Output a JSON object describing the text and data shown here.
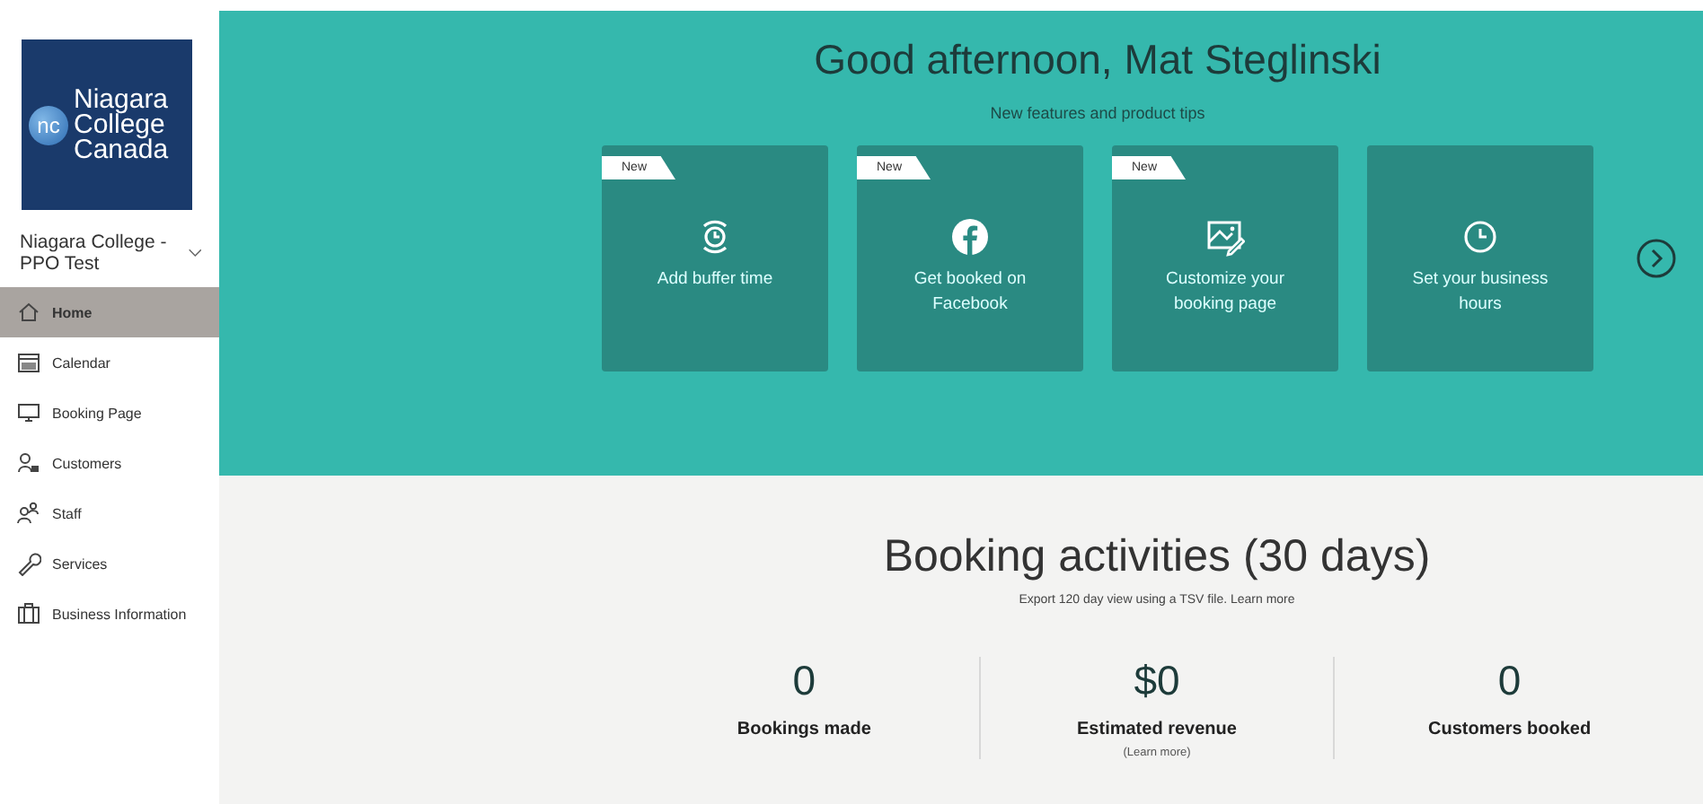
{
  "sidebar": {
    "logo": {
      "mark": "nc",
      "lines": [
        "Niagara",
        "College",
        "Canada"
      ]
    },
    "org": {
      "name": "Niagara College - PPO Test"
    },
    "items": [
      {
        "kind": "home",
        "label": "Home",
        "selected": true
      },
      {
        "kind": "calendar",
        "label": "Calendar",
        "selected": false
      },
      {
        "kind": "monitor",
        "label": "Booking Page",
        "selected": false
      },
      {
        "kind": "customers",
        "label": "Customers",
        "selected": false
      },
      {
        "kind": "staff",
        "label": "Staff",
        "selected": false
      },
      {
        "kind": "services",
        "label": "Services",
        "selected": false
      },
      {
        "kind": "business",
        "label": "Business Information",
        "selected": false
      }
    ]
  },
  "banner": {
    "greeting": "Good afternoon, Mat Steglinski",
    "subtitle": "New features and product tips",
    "cards": [
      {
        "kind": "buffer",
        "badge": "New",
        "label": "Add buffer time"
      },
      {
        "kind": "facebook",
        "badge": "New",
        "label": "Get booked on Facebook"
      },
      {
        "kind": "image",
        "badge": "New",
        "label": "Customize your booking page"
      },
      {
        "kind": "clock",
        "label": "Set your business hours"
      }
    ]
  },
  "activities": {
    "title": "Booking activities (30 days)",
    "subtitle": "Export 120 day view using a TSV file. Learn more",
    "stats": [
      {
        "value": "0",
        "label": "Bookings made"
      },
      {
        "value": "$0",
        "label": "Estimated revenue",
        "link": "(Learn more)"
      },
      {
        "value": "0",
        "label": "Customers booked"
      }
    ]
  }
}
